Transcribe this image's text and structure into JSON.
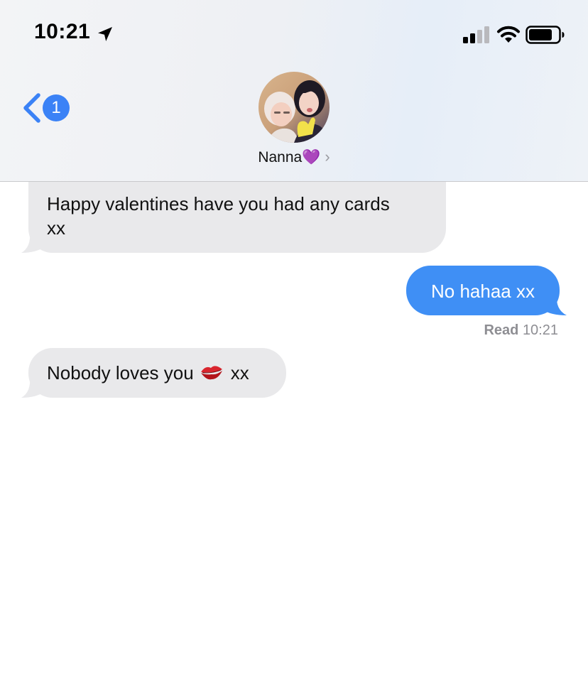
{
  "status_bar": {
    "time": "10:21",
    "icons": [
      "location-arrow-icon",
      "cellular-signal-icon",
      "wifi-icon",
      "battery-icon"
    ]
  },
  "nav": {
    "back_badge_count": "1",
    "contact_name": "Nanna💜",
    "contact_chevron": "›",
    "avatar": "contact-avatar-photo"
  },
  "messages": [
    {
      "direction": "incoming",
      "text": "Happy valentines have you had any cards\nxx"
    },
    {
      "direction": "outgoing",
      "text": "No hahaa xx"
    },
    {
      "direction": "incoming",
      "text_before": "Nobody loves you",
      "emoji": "kiss-mark-icon",
      "text_after": "xx"
    }
  ],
  "read_receipt": {
    "label": "Read",
    "time": "10:21"
  },
  "colors": {
    "incoming_bubble": "#e9e9eb",
    "outgoing_bubble": "#3f8ff5",
    "accent": "#3b82f6",
    "receipt_text": "#8e8e93"
  }
}
